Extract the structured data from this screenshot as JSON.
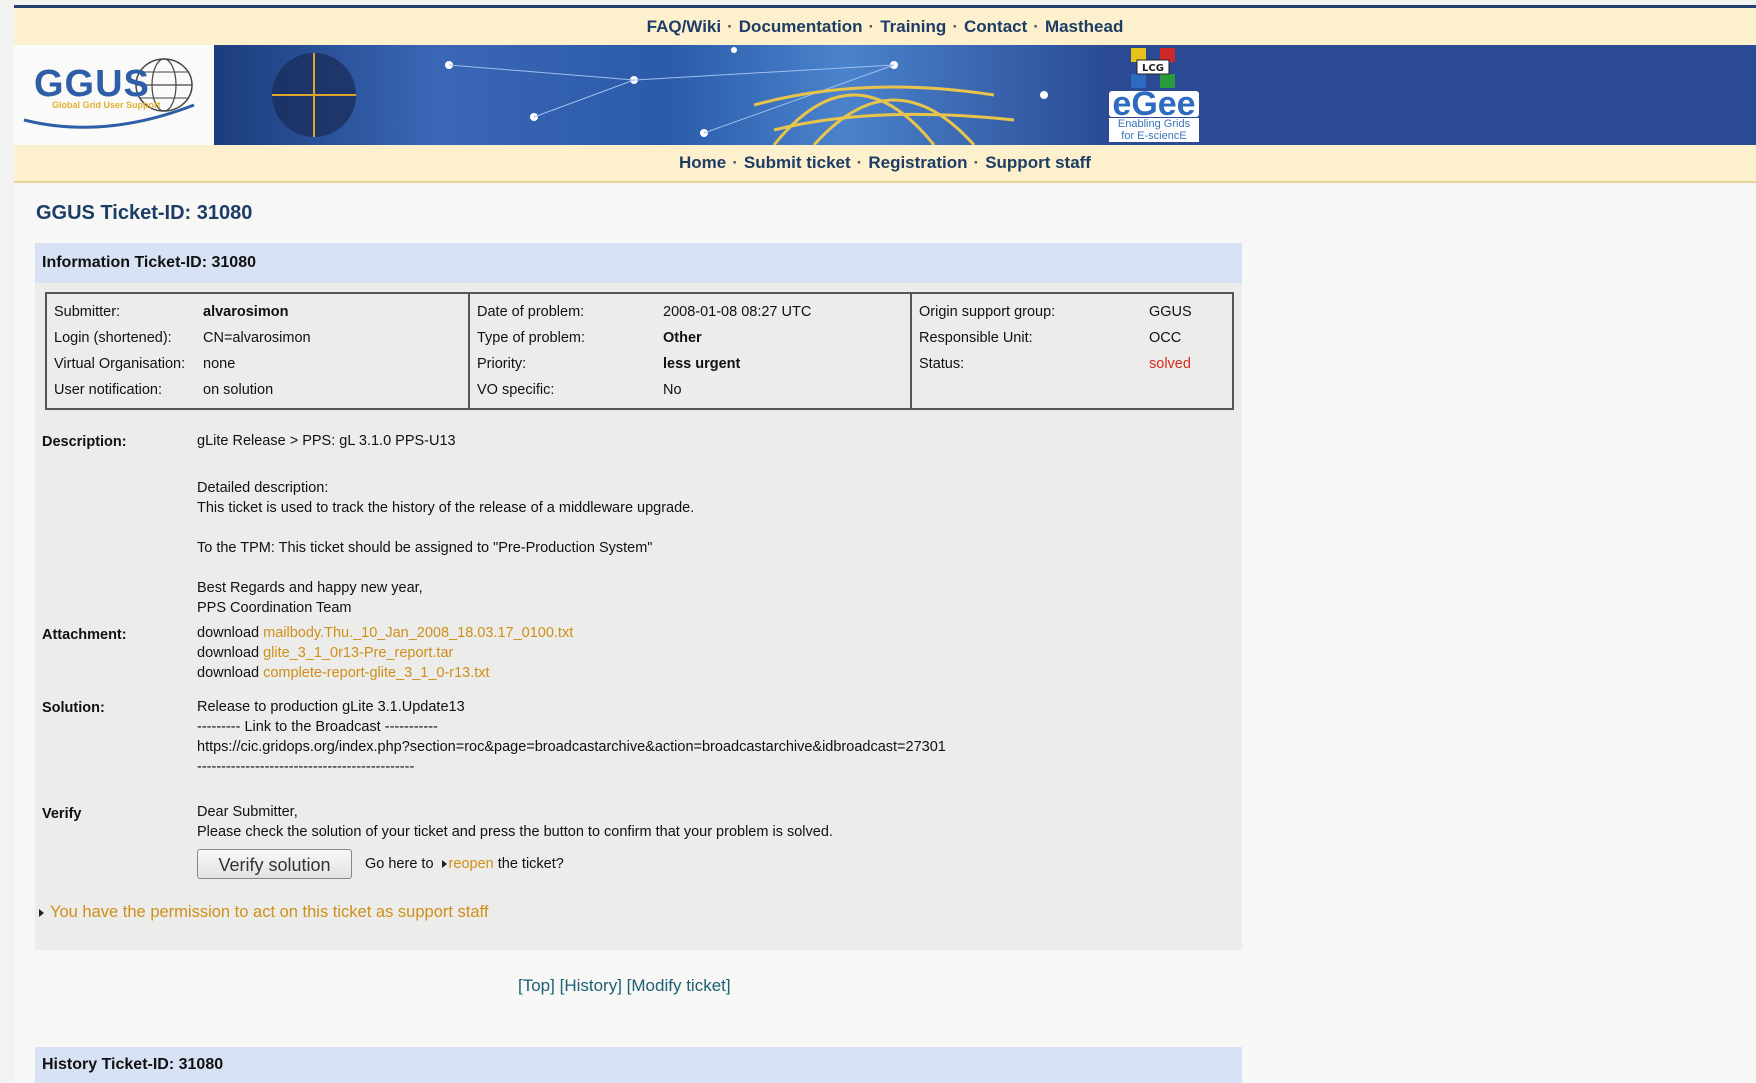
{
  "topnav": [
    "FAQ/Wiki",
    "Documentation",
    "Training",
    "Contact",
    "Masthead"
  ],
  "banner": {
    "logo_text": "GGUS",
    "logo_sub": "Global Grid User Support",
    "egee_text": "eGee",
    "egee_sub1": "Enabling Grids",
    "egee_sub2": "for E-sciencE",
    "lcg_text": "LCG"
  },
  "bottomnav": [
    "Home",
    "Submit ticket",
    "Registration",
    "Support staff"
  ],
  "page_title": "GGUS Ticket-ID: 31080",
  "info": {
    "header": "Information Ticket-ID: 31080",
    "col1": [
      {
        "k": "Submitter:",
        "v": "alvarosimon"
      },
      {
        "k": "Login (shortened):",
        "v": "CN=alvarosimon"
      },
      {
        "k": "Virtual Organisation:",
        "v": "none"
      },
      {
        "k": "User notification:",
        "v": "on solution"
      }
    ],
    "col2": [
      {
        "k": "Date of problem:",
        "v": "2008-01-08 08:27 UTC"
      },
      {
        "k": "Type of problem:",
        "v": "Other"
      },
      {
        "k": "Priority:",
        "v": "less urgent"
      },
      {
        "k": "VO specific:",
        "v": "No"
      }
    ],
    "col3": [
      {
        "k": "Origin support group:",
        "v": "GGUS"
      },
      {
        "k": "Responsible Unit:",
        "v": "OCC"
      },
      {
        "k": "Status:",
        "v": "solved"
      }
    ]
  },
  "description": {
    "label": "Description:",
    "lines": [
      "gLite Release > PPS: gL 3.1.0 PPS-U13",
      "Detailed description:",
      "This ticket is used to track the history of the release of a middleware upgrade.",
      "To the TPM: This ticket should be assigned to \"Pre-Production System\"",
      "Best Regards and happy new year,",
      "PPS Coordination Team"
    ]
  },
  "attachment": {
    "label": "Attachment:",
    "prefix": "download",
    "files": [
      "mailbody.Thu._10_Jan_2008_18.03.17_0100.txt",
      "glite_3_1_0r13-Pre_report.tar",
      "complete-report-glite_3_1_0-r13.txt"
    ]
  },
  "solution": {
    "label": "Solution:",
    "lines": [
      "Release to production gLite 3.1.Update13",
      "--------- Link to the Broadcast -----------",
      "https://cic.gridops.org/index.php?section=roc&page=broadcastarchive&action=broadcastarchive&idbroadcast=27301",
      "---------------------------------------------"
    ]
  },
  "verify": {
    "label": "Verify",
    "line1": "Dear Submitter,",
    "line2": "Please check the solution of your ticket and press the button to confirm that your problem is solved.",
    "button": "Verify solution",
    "reopen_pre": "Go here to",
    "reopen_link": "reopen",
    "reopen_post": "the ticket?"
  },
  "permission": "You have the permission to act on this ticket as support staff",
  "bottom_links": [
    "[Top]",
    "[History]",
    "[Modify ticket]"
  ],
  "history_header": "History Ticket-ID: 31080"
}
